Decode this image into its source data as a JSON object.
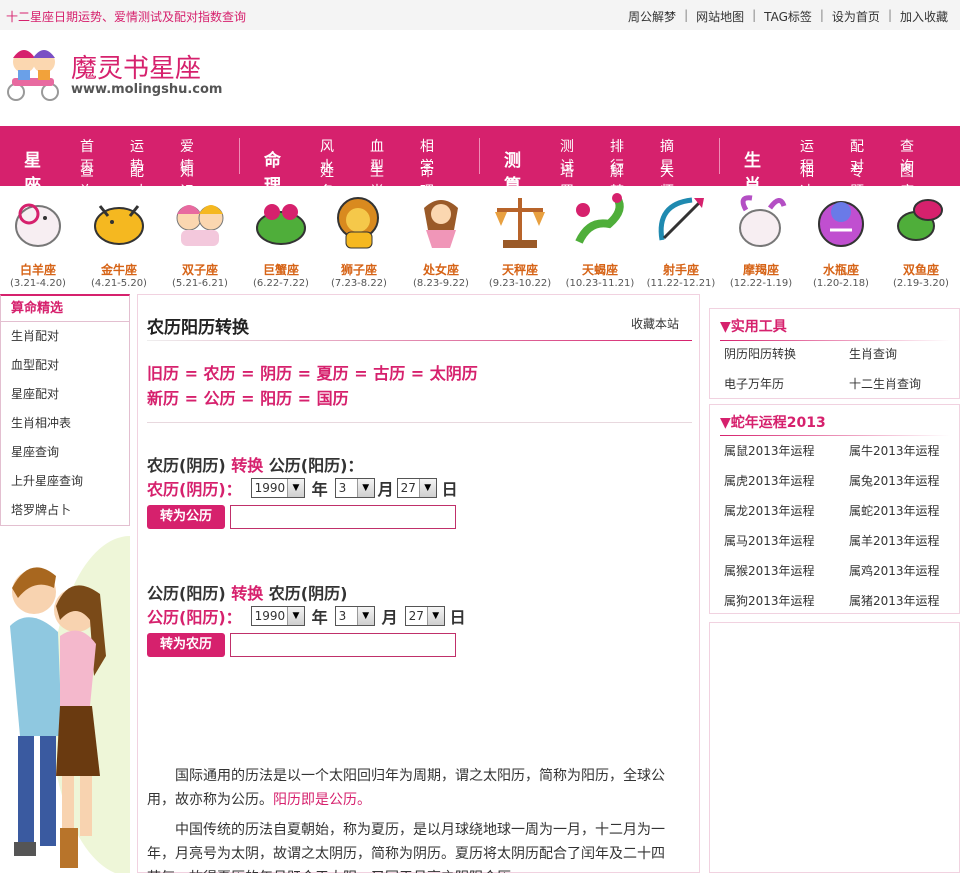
{
  "topbar": {
    "slogan": "十二星座日期运势、爱情测试及配对指数查询",
    "links": [
      "周公解梦",
      "网站地图",
      "TAG标签",
      "设为首页",
      "加入收藏"
    ]
  },
  "logo": {
    "brand": "魔灵书星座",
    "url": "www.molingshu.com"
  },
  "nav": {
    "groups": [
      {
        "title": "星座",
        "items": [
          "首页",
          "运势",
          "爱情",
          "查询",
          "配对",
          "知识"
        ]
      },
      {
        "title": "命理",
        "items": [
          "风水",
          "血型",
          "相学",
          "姓名",
          "生肖",
          "命理"
        ]
      },
      {
        "title": "测算",
        "items": [
          "测试",
          "排行",
          "摘星",
          "塔罗",
          "解梦",
          "大师"
        ]
      },
      {
        "title": "生肖",
        "items": [
          "运程",
          "配对",
          "查询",
          "相冲",
          "专题",
          "图库"
        ]
      }
    ]
  },
  "zodiac": [
    {
      "name": "白羊座",
      "date": "(3.21-4.20)"
    },
    {
      "name": "金牛座",
      "date": "(4.21-5.20)"
    },
    {
      "name": "双子座",
      "date": "(5.21-6.21)"
    },
    {
      "name": "巨蟹座",
      "date": "(6.22-7.22)"
    },
    {
      "name": "狮子座",
      "date": "(7.23-8.22)"
    },
    {
      "name": "处女座",
      "date": "(8.23-9.22)"
    },
    {
      "name": "天秤座",
      "date": "(9.23-10.22)"
    },
    {
      "name": "天蝎座",
      "date": "(10.23-11.21)"
    },
    {
      "name": "射手座",
      "date": "(11.22-12.21)"
    },
    {
      "name": "摩羯座",
      "date": "(12.22-1.19)"
    },
    {
      "name": "水瓶座",
      "date": "(1.20-2.18)"
    },
    {
      "name": "双鱼座",
      "date": "(2.19-3.20)"
    }
  ],
  "leftbox": {
    "title": "算命精选",
    "items": [
      "生肖配对",
      "血型配对",
      "星座配对",
      "生肖相冲表",
      "星座查询",
      "上升星座查询",
      "塔罗牌占卜"
    ]
  },
  "main": {
    "title": "农历阳历转换",
    "fav": "收藏本站",
    "eq1": "旧历 = 农历 = 阴历 = 夏历 = 古历 = 太阴历",
    "eq2": "新历 = 公历 = 阳历 = 国历",
    "sec1": {
      "a": "农历(阴历) ",
      "b": "转换",
      "c": " 公历(阳历)："
    },
    "row1": {
      "label": "农历(阴历)：",
      "year": "1990",
      "y": "年",
      "month": "3",
      "m": "月",
      "day": "27",
      "d": "日"
    },
    "btn1": "转为公历",
    "sec2": {
      "a": "公历(阳历) ",
      "b": "转换",
      "c": " 农历(阴历)"
    },
    "row2": {
      "label": "公历(阳历)：",
      "year": "1990",
      "y": "年",
      "month": "3",
      "m": "月",
      "day": "27",
      "d": "日"
    },
    "btn2": "转为农历",
    "p1a": "国际通用的历法是以一个太阳回归年为周期，谓之太阳历，简称为阳历，全球公用，故亦称为公历。",
    "p1b": "阳历即是公历。",
    "p2": "中国传统的历法自夏朝始，称为夏历，是以月球绕地球一周为一月，十二月为一年，月亮号为太阴，故谓之太阴历，简称为阴历。夏历将太阴历配合了闰年及二十四节气，故得夏历的年月既合于太阳，又同于月亮之阴阳合历。"
  },
  "tools": {
    "title": "▼实用工具",
    "items": [
      "阴历阳历转换",
      "生肖查询",
      "电子万年历",
      "十二生肖查询"
    ]
  },
  "snake": {
    "title": "▼蛇年运程2013",
    "items": [
      "属鼠2013年运程",
      "属牛2013年运程",
      "属虎2013年运程",
      "属兔2013年运程",
      "属龙2013年运程",
      "属蛇2013年运程",
      "属马2013年运程",
      "属羊2013年运程",
      "属猴2013年运程",
      "属鸡2013年运程",
      "属狗2013年运程",
      "属猪2013年运程"
    ]
  },
  "colors": {
    "accent": "#d6216d",
    "zodiac_name": "#d66316"
  }
}
